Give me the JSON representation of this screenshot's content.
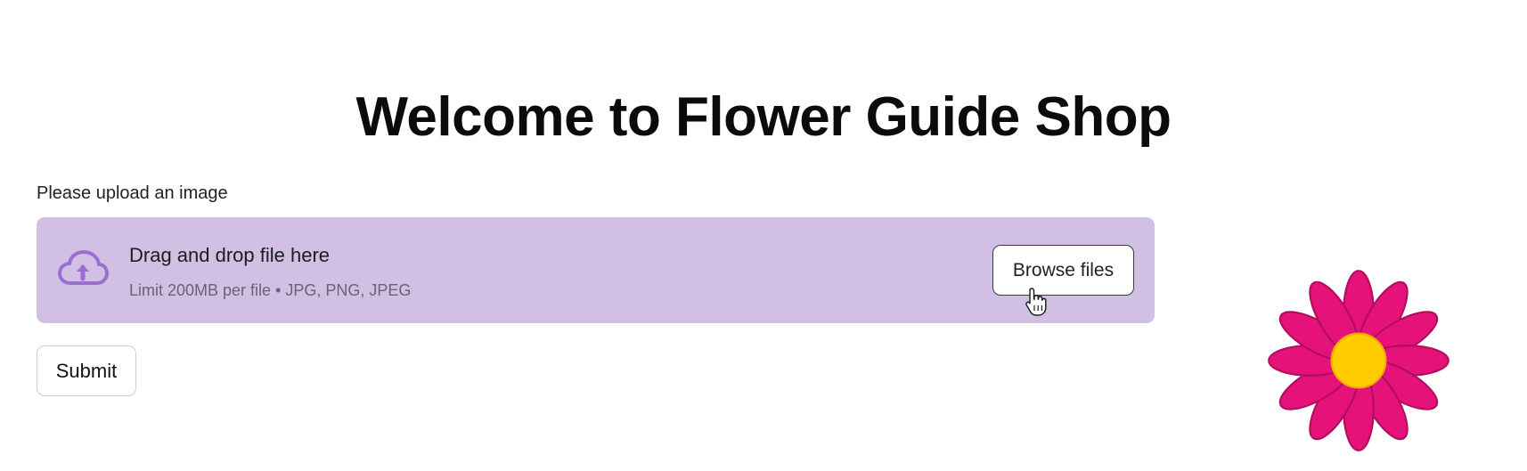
{
  "header": {
    "title": "Welcome to Flower Guide Shop"
  },
  "uploader": {
    "label": "Please upload an image",
    "dropzone_title": "Drag and drop file here",
    "dropzone_limit": "Limit 200MB per file • JPG, PNG, JPEG",
    "browse_label": "Browse files",
    "icon": "cloud-upload-icon"
  },
  "form": {
    "submit_label": "Submit"
  },
  "decoration": {
    "image": "flower-icon"
  },
  "colors": {
    "dropzone_bg": "#d2c0e4",
    "icon_purple": "#9a6fcf",
    "petal": "#e5127a",
    "flower_center": "#ffcc00"
  }
}
